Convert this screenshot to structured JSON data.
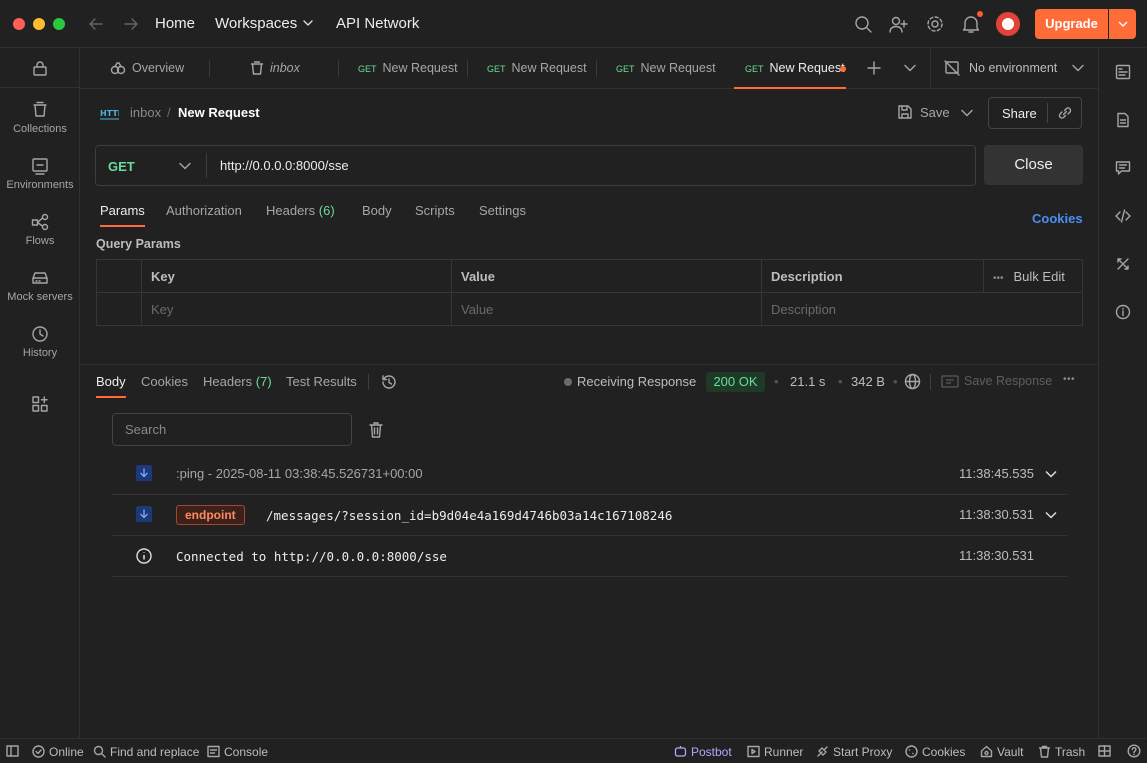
{
  "colors": {
    "accent": "#ff6c37",
    "get_method": "#6bdd9a",
    "link": "#4c8ef2",
    "ok_badge_bg": "#1d3a26",
    "endpoint_badge": "#e8744f",
    "download_icon_bg": "#1c3a78"
  },
  "titlebar": {
    "nav": {
      "home": "Home",
      "workspaces": "Workspaces",
      "api_network": "API Network"
    },
    "upgrade_label": "Upgrade"
  },
  "sidebar": {
    "items": [
      {
        "label": "Collections",
        "icon": "collections-icon"
      },
      {
        "label": "Environments",
        "icon": "environments-icon"
      },
      {
        "label": "Flows",
        "icon": "flows-icon"
      },
      {
        "label": "Mock servers",
        "icon": "mock-servers-icon"
      },
      {
        "label": "History",
        "icon": "history-icon"
      }
    ]
  },
  "tabs": {
    "items": [
      {
        "method": "",
        "label": "Overview"
      },
      {
        "method": "",
        "label": "inbox"
      },
      {
        "method": "GET",
        "label": "New Request"
      },
      {
        "method": "GET",
        "label": "New Request"
      },
      {
        "method": "GET",
        "label": "New Request"
      },
      {
        "method": "GET",
        "label": "New Request"
      }
    ],
    "environment": "No environment"
  },
  "request": {
    "breadcrumb": {
      "parent": "inbox",
      "separator": "/",
      "current": "New Request"
    },
    "save_label": "Save",
    "share_label": "Share",
    "method": "GET",
    "url": "http://0.0.0.0:8000/sse",
    "close_label": "Close",
    "tabs": {
      "params": "Params",
      "authorization": "Authorization",
      "headers": "Headers",
      "headers_count": "(6)",
      "body": "Body",
      "scripts": "Scripts",
      "settings": "Settings"
    },
    "cookies_link": "Cookies",
    "query_params": {
      "title": "Query Params",
      "columns": {
        "key": "Key",
        "value": "Value",
        "description": "Description",
        "bulk_edit": "Bulk Edit"
      },
      "placeholders": {
        "key": "Key",
        "value": "Value",
        "description": "Description"
      }
    }
  },
  "response": {
    "tabs": {
      "body": "Body",
      "cookies": "Cookies",
      "headers": "Headers",
      "headers_count": "(7)",
      "test_results": "Test Results"
    },
    "status_text": "Receiving Response",
    "status_code": "200 OK",
    "time": "21.1 s",
    "size": "342 B",
    "save_response": "Save Response",
    "search_placeholder": "Search",
    "events": [
      {
        "type": "",
        "text": ":ping - 2025-08-11 03:38:45.526731+00:00",
        "time": "11:38:45.535"
      },
      {
        "type": "endpoint",
        "text": "/messages/?session_id=b9d04e4a169d4746b03a14c167108246",
        "time": "11:38:30.531"
      },
      {
        "type": "",
        "text": "Connected to http://0.0.0.0:8000/sse",
        "time": "11:38:30.531"
      }
    ]
  },
  "statusbar": {
    "online": "Online",
    "find_replace": "Find and replace",
    "console": "Console",
    "postbot": "Postbot",
    "runner": "Runner",
    "start_proxy": "Start Proxy",
    "cookies": "Cookies",
    "vault": "Vault",
    "trash": "Trash"
  }
}
